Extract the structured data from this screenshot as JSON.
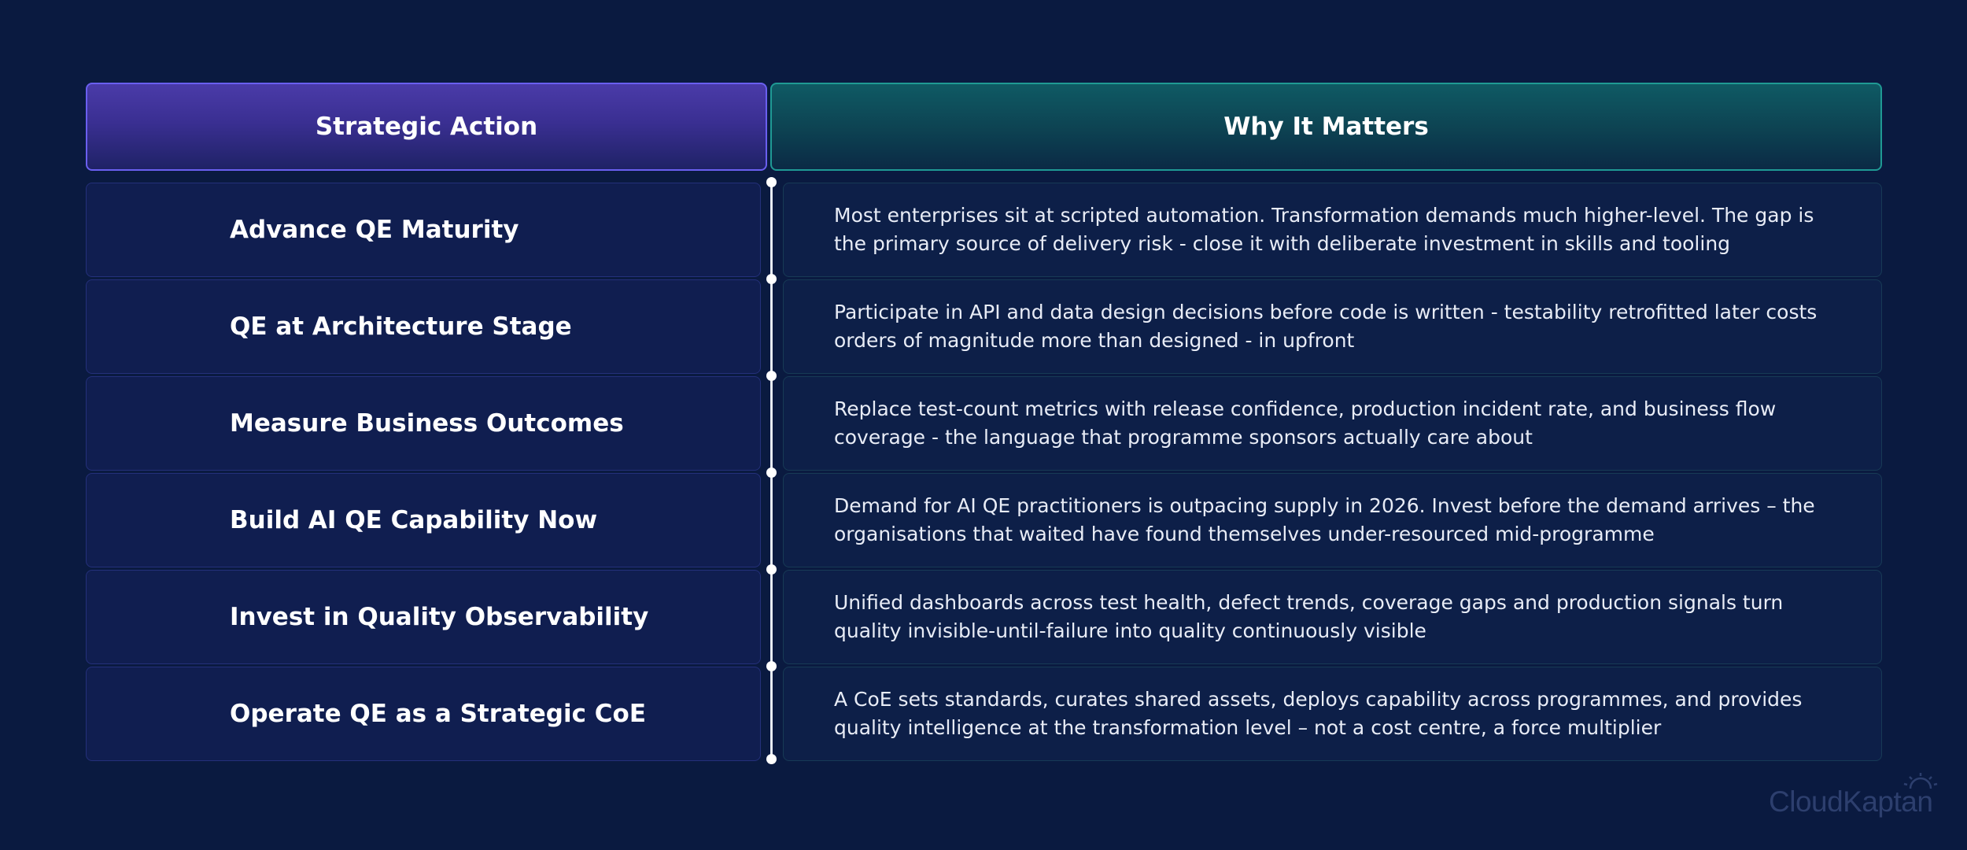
{
  "headers": {
    "left": "Strategic Action",
    "right": "Why It Matters"
  },
  "rows": [
    {
      "action": "Advance QE Maturity",
      "why": "Most enterprises sit at scripted automation. Transformation demands much higher-level. The gap is the primary source of delivery risk - close it with deliberate investment in skills and tooling"
    },
    {
      "action": "QE at Architecture Stage",
      "why": "Participate in API and data design decisions before code is written - testability retrofitted later costs orders of magnitude more than designed - in upfront"
    },
    {
      "action": "Measure Business Outcomes",
      "why": "Replace test-count metrics with release confidence, production incident rate, and business flow coverage - the language that programme sponsors actually care about"
    },
    {
      "action": "Build AI QE Capability Now",
      "why": "Demand for AI QE practitioners is outpacing supply in 2026. Invest before the demand arrives – the organisations that waited have found themselves under-resourced mid-programme"
    },
    {
      "action": "Invest in Quality Observability",
      "why": "Unified dashboards across test health, defect trends, coverage gaps and production signals turn quality invisible-until-failure into quality continuously visible"
    },
    {
      "action": "Operate QE as a Strategic CoE",
      "why": "A CoE sets standards, curates shared assets, deploys capability across programmes, and provides quality intelligence at the transformation level – not a cost centre, a force multiplier"
    }
  ],
  "brand": {
    "name": "CloudKaptan",
    "icon": "sun-rays-icon"
  },
  "colors": {
    "background": "#0a1a40",
    "left_header_border": "#6a5ff0",
    "right_header_border": "#1f9a94",
    "timeline": "#e8ecf6"
  }
}
